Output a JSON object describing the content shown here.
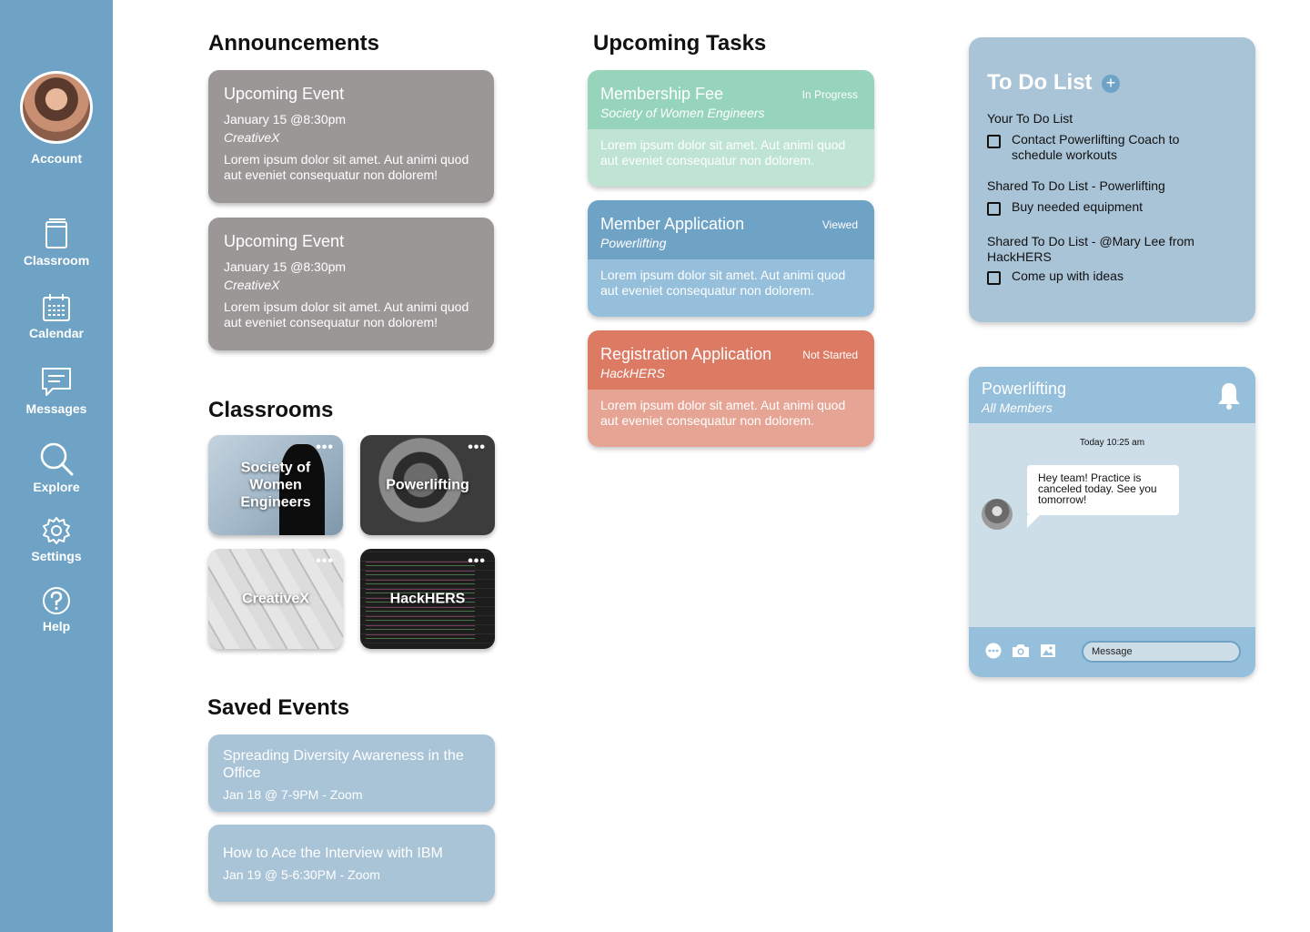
{
  "sidebar": {
    "account_label": "Account",
    "items": [
      {
        "label": "Classroom",
        "icon": "book-icon"
      },
      {
        "label": "Calendar",
        "icon": "calendar-icon"
      },
      {
        "label": "Messages",
        "icon": "message-icon"
      },
      {
        "label": "Explore",
        "icon": "search-icon"
      },
      {
        "label": "Settings",
        "icon": "gear-icon"
      },
      {
        "label": "Help",
        "icon": "help-icon"
      }
    ]
  },
  "announcements": {
    "title": "Announcements",
    "cards": [
      {
        "title": "Upcoming Event",
        "date": "January 15 @8:30pm",
        "org": "CreativeX",
        "desc": "Lorem ipsum dolor sit amet. Aut animi quod aut eveniet consequatur non dolorem!"
      },
      {
        "title": "Upcoming Event",
        "date": "January 15 @8:30pm",
        "org": "CreativeX",
        "desc": "Lorem ipsum dolor sit amet. Aut animi quod aut eveniet consequatur non dolorem!"
      }
    ]
  },
  "classrooms": {
    "title": "Classrooms",
    "tiles": [
      {
        "name": "Society of Women Engineers"
      },
      {
        "name": "Powerlifting"
      },
      {
        "name": "CreativeX"
      },
      {
        "name": "HackHERS"
      }
    ],
    "more_icon": "•••"
  },
  "saved_events": {
    "title": "Saved Events",
    "items": [
      {
        "title": "Spreading Diversity Awareness in the Office",
        "sub": "Jan 18 @ 7-9PM - Zoom"
      },
      {
        "title": "How to Ace the Interview with IBM",
        "sub": "Jan 19 @ 5-6:30PM - Zoom"
      }
    ]
  },
  "tasks": {
    "title": "Upcoming Tasks",
    "items": [
      {
        "title": "Membership Fee",
        "org": "Society of Women Engineers",
        "status": "In Progress",
        "desc": "Lorem ipsum dolor sit amet. Aut animi quod aut eveniet consequatur non dolorem."
      },
      {
        "title": "Member Application",
        "org": "Powerlifting",
        "status": "Viewed",
        "desc": "Lorem ipsum dolor sit amet. Aut animi quod aut eveniet consequatur non dolorem."
      },
      {
        "title": "Registration Application",
        "org": "HackHERS",
        "status": "Not Started",
        "desc": "Lorem ipsum dolor sit amet. Aut animi quod aut eveniet consequatur non dolorem."
      }
    ],
    "colors": {
      "in_progress": "#96d4bb",
      "viewed": "#6fa3c6",
      "not_started": "#dc7a64"
    }
  },
  "todo": {
    "title": "To Do List",
    "add_icon": "+",
    "groups": [
      {
        "label": "Your To Do List",
        "items": [
          "Contact Powerlifting Coach to schedule workouts"
        ]
      },
      {
        "label": "Shared To Do List - Powerlifting",
        "items": [
          "Buy needed equipment"
        ]
      },
      {
        "label": "Shared To Do List - @Mary Lee from HackHERS",
        "items": [
          "Come up with ideas"
        ]
      }
    ]
  },
  "chat": {
    "name": "Powerlifting",
    "sub": "All Members",
    "time": "Today 10:25 am",
    "message": "Hey team! Practice is canceled today. See you tomorrow!",
    "input_placeholder": "Message",
    "icons": [
      "more-icon",
      "camera-icon",
      "image-icon",
      "bell-icon"
    ]
  },
  "colors": {
    "sidebar": "#6fa3c6",
    "panel": "#a9c4d7",
    "announcement": "#9b9797"
  }
}
